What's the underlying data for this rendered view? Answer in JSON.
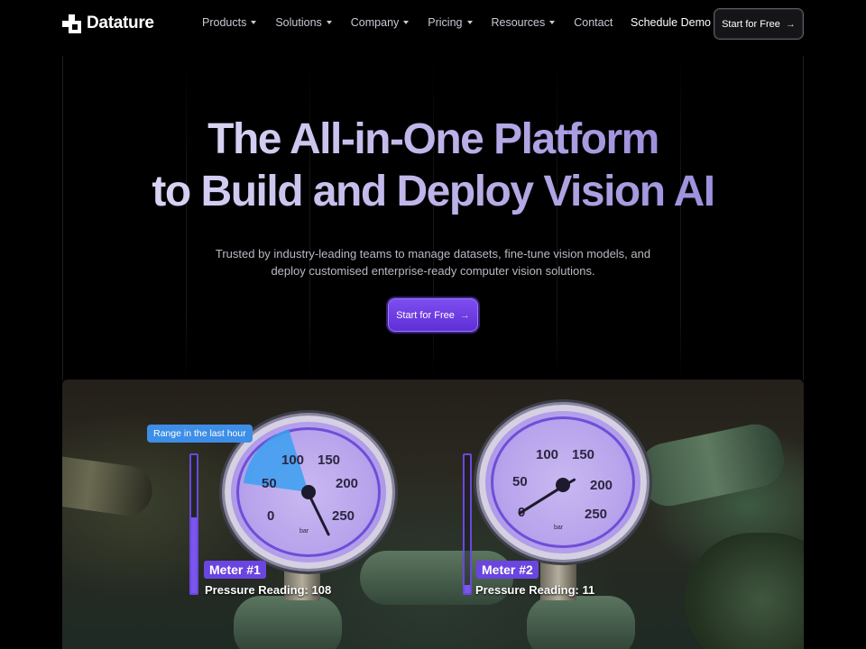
{
  "brand": {
    "name": "Datature"
  },
  "nav": {
    "items": [
      {
        "label": "Products",
        "has_menu": true
      },
      {
        "label": "Solutions",
        "has_menu": true
      },
      {
        "label": "Company",
        "has_menu": true
      },
      {
        "label": "Pricing",
        "has_menu": true
      },
      {
        "label": "Resources",
        "has_menu": true
      },
      {
        "label": "Contact",
        "has_menu": false
      }
    ],
    "schedule_label": "Schedule Demo",
    "start_label": "Start for Free"
  },
  "hero": {
    "headline_line1": "The All-in-One Platform",
    "headline_line2": "to Build and Deploy Vision AI",
    "subtitle_line1": "Trusted by industry-leading teams to manage datasets, fine-tune vision models,  and",
    "subtitle_line2": "deploy customised enterprise-ready computer vision solutions.",
    "cta_label": "Start for Free"
  },
  "demo": {
    "range_label": "Range in the last hour",
    "meter1": {
      "tag": "Meter #1",
      "reading_label": "Pressure Reading:",
      "reading_value": "108",
      "level": 0.55
    },
    "meter2": {
      "tag": "Meter #2",
      "reading_label": "Pressure Reading:",
      "reading_value": "11",
      "level": 0.06
    },
    "gauge_numbers": [
      "0",
      "50",
      "100",
      "150",
      "200",
      "250"
    ],
    "gauge_unit": "bar"
  },
  "colors": {
    "accent": "#6b45e0",
    "range_tag": "#3d8ee6",
    "background": "#000000"
  }
}
